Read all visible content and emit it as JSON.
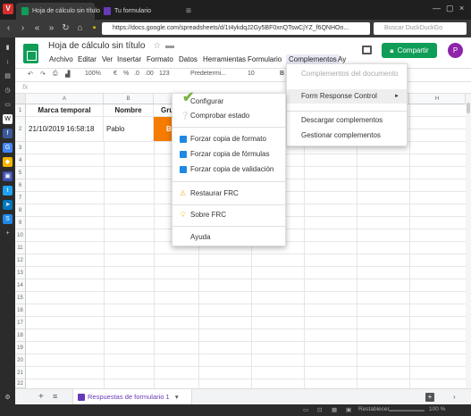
{
  "browser": {
    "tabs": [
      {
        "label": "Hoja de cálculo sin título",
        "active": true
      },
      {
        "label": "Tu formulario",
        "active": false
      }
    ],
    "url": "https://docs.google.com/spreadsheets/d/1t4ykdqJ2Gy5BF0xnQTswCjYZ_f6QNHOn...",
    "search_placeholder": "Buscar DuckDuckGo",
    "status_left": "",
    "status_right_label": "Restablecer",
    "zoom": "100 %"
  },
  "sheets": {
    "title": "Hoja de cálculo sin título",
    "menus": [
      "Archivo",
      "Editar",
      "Ver",
      "Insertar",
      "Formato",
      "Datos",
      "Herramientas",
      "Formulario",
      "Complementos",
      "Ay"
    ],
    "share_label": "Compartir",
    "avatar_initial": "P",
    "toolbar": {
      "zoom": "100%",
      "currency": "€",
      "percent": "%",
      "decimals_less": ".0",
      "decimals_more": ".00",
      "format_123": "123",
      "font": "Predetermi...",
      "font_size": "10",
      "bold": "B"
    },
    "fx": "fx",
    "columns": [
      "A",
      "B",
      "C",
      "D",
      "E",
      "F",
      "G",
      "H"
    ],
    "rows": [
      "1",
      "2",
      "3",
      "4",
      "5",
      "6",
      "7",
      "8",
      "9",
      "10",
      "11",
      "12",
      "13",
      "14",
      "15",
      "16",
      "17",
      "18",
      "19",
      "20",
      "21",
      "22",
      "23"
    ],
    "row1": {
      "a": "Marca temporal",
      "b": "Nombre",
      "c": "Grup"
    },
    "row2": {
      "a": "21/10/2019 16:58:18",
      "b": "Pablo",
      "c": "B"
    },
    "sheet_tab": "Respuestas de formulario 1",
    "add_sheet": "+",
    "all_sheets": "≡"
  },
  "complementos_menu": {
    "items": [
      {
        "label": "Complementos del documento",
        "disabled": true
      },
      {
        "label": "Form Response Control",
        "submenu": true
      },
      {
        "label": "Descargar complementos"
      },
      {
        "label": "Gestionar complementos"
      }
    ]
  },
  "frc_submenu": {
    "items": [
      {
        "label": "Configurar",
        "icon": "check-icon"
      },
      {
        "label": "Comprobar estado",
        "icon": "question-icon"
      },
      {
        "label": "Forzar copia de formato",
        "icon": "download-icon"
      },
      {
        "label": "Forzar copia de fórmulas",
        "icon": "download-icon"
      },
      {
        "label": "Forzar copia de validación",
        "icon": "download-icon"
      },
      {
        "label": "Restaurar FRC",
        "icon": "warning-icon"
      },
      {
        "label": "Sobre FRC",
        "icon": "lightbulb-icon"
      },
      {
        "label": "Ayuda"
      }
    ]
  },
  "colors": {
    "green": "#0f9d58",
    "accent_orange": "#f57c00",
    "purple": "#673ab7",
    "vivaldi_red": "#d32f2f"
  }
}
